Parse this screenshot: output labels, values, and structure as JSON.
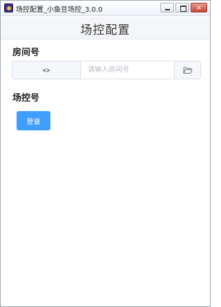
{
  "window": {
    "title": "场控配置_小鱼豆场控_3.0.0",
    "controls": {
      "minimize": "",
      "maximize": "",
      "close": "×"
    }
  },
  "header": {
    "title": "场控配置"
  },
  "room": {
    "label": "房间号",
    "input_value": "",
    "placeholder": "请输入房间号",
    "left_icon": "eye-icon",
    "right_icon": "folder-open-icon"
  },
  "control": {
    "label": "场控号"
  },
  "actions": {
    "login_label": "登录"
  },
  "colors": {
    "primary": "#409eff",
    "addon_bg": "#f5f7fa",
    "border": "#dcdfe6"
  }
}
